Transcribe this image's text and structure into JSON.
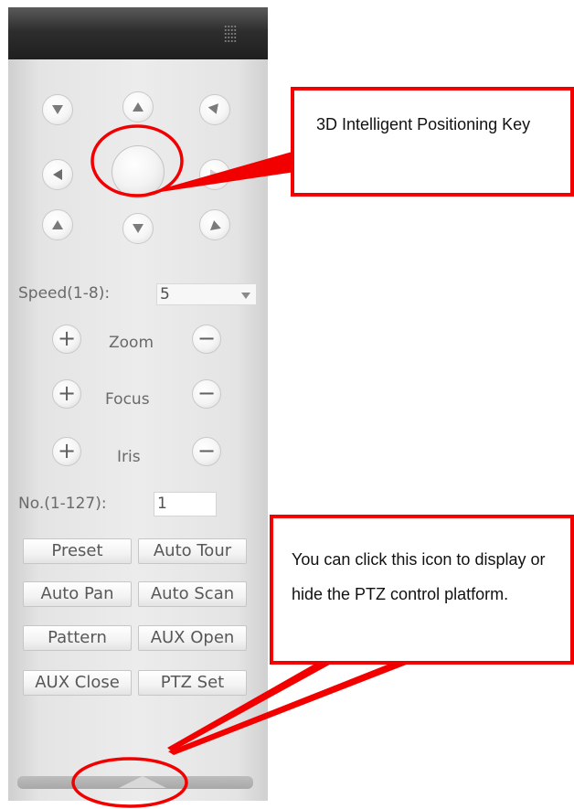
{
  "ptz_panel": {
    "speed_label": "Speed(1-8):",
    "speed_value": "5",
    "zoom_label": "Zoom",
    "focus_label": "Focus",
    "iris_label": "Iris",
    "plus_symbol": "+",
    "minus_symbol": "−",
    "no_label": "No.(1-127):",
    "no_value": "1",
    "buttons": {
      "preset": "Preset",
      "auto_tour": "Auto Tour",
      "auto_pan": "Auto Pan",
      "auto_scan": "Auto Scan",
      "pattern": "Pattern",
      "aux_open": "AUX Open",
      "aux_close": "AUX Close",
      "ptz_set": "PTZ Set"
    }
  },
  "callouts": {
    "positioning_key": "3D Intelligent Positioning Key",
    "toggle_panel": "You can click this icon to display or hide the PTZ control platform."
  },
  "icons": {
    "direction_buttons": [
      "down-icon",
      "up-icon",
      "down-icon",
      "left-icon",
      "right-icon",
      "up-icon",
      "down-icon",
      "up-icon"
    ],
    "center_button": "3d-positioning-icon",
    "collapse_toggle": "chevron-up-icon"
  },
  "colors": {
    "callout_border": "#f20000",
    "panel_header": "#2e2e2e",
    "panel_body": "#e8e8e8"
  }
}
